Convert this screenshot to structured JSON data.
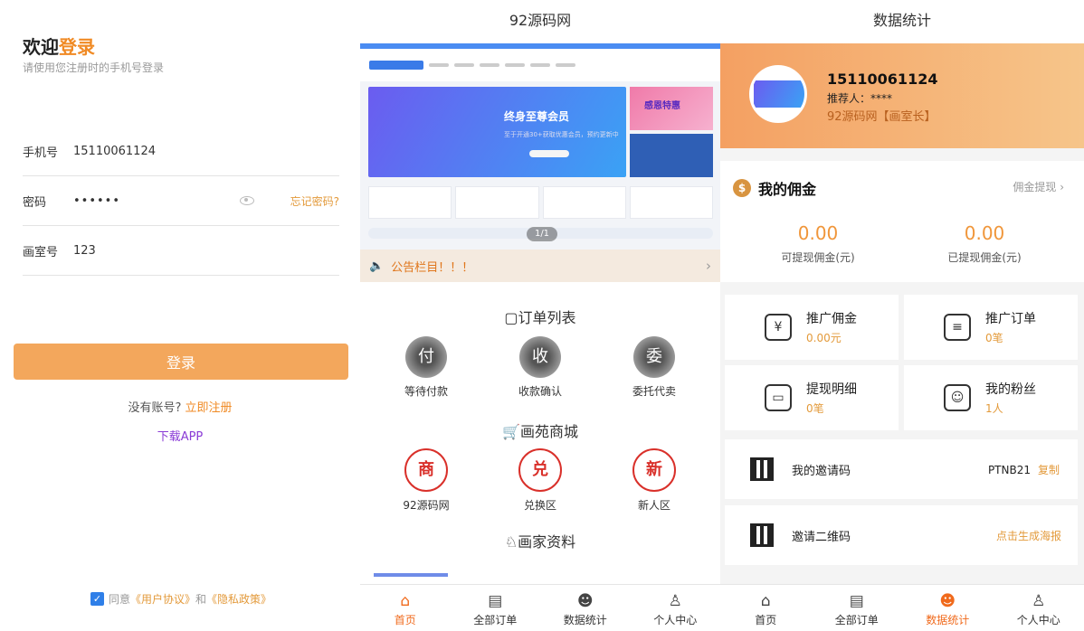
{
  "login": {
    "welcome_prefix": "欢迎",
    "welcome_highlight": "登录",
    "subtitle": "请使用您注册时的手机号登录",
    "phone_label": "手机号",
    "phone_value": "15110061124",
    "password_label": "密码",
    "password_value": "••••••",
    "forgot": "忘记密码?",
    "studio_label": "画室号",
    "studio_value": "123",
    "button": "登录",
    "no_account": "没有账号?",
    "register": "立即注册",
    "download": "下载APP",
    "agree_prefix": "同意",
    "user_agreement": "《用户协议》",
    "and": "和",
    "privacy": "《隐私政策》"
  },
  "home": {
    "title": "92源码网",
    "banner_headline": "终身至尊会员",
    "banner_sub": "至于开通30+获取优惠会员，预约更新中",
    "banner_side": "感恩特惠",
    "pager": "1/1",
    "notice": "公告栏目！！！",
    "orders_title": "订单列表",
    "orders": [
      {
        "glyph": "付",
        "label": "等待付款"
      },
      {
        "glyph": "收",
        "label": "收款确认"
      },
      {
        "glyph": "委",
        "label": "委托代卖"
      }
    ],
    "mall_title": "画苑商城",
    "mall": [
      {
        "glyph": "商",
        "label": "92源码网"
      },
      {
        "glyph": "兑",
        "label": "兑换区"
      },
      {
        "glyph": "新",
        "label": "新人区"
      }
    ],
    "artist_title": "画家资料"
  },
  "tabs": [
    {
      "icon": "⌂",
      "label": "首页"
    },
    {
      "icon": "▤",
      "label": "全部订单"
    },
    {
      "icon": "☻",
      "label": "数据统计"
    },
    {
      "icon": "♙",
      "label": "个人中心"
    }
  ],
  "stats": {
    "title": "数据统计",
    "name": "15110061124",
    "referrer": "推荐人：****",
    "studio": "92源码网【画室长】",
    "commission_title": "我的佣金",
    "withdraw_link": "佣金提现 ›",
    "withdrawable_value": "0.00",
    "withdrawable_label": "可提现佣金(元)",
    "withdrawn_value": "0.00",
    "withdrawn_label": "已提现佣金(元)",
    "cards": [
      {
        "icon": "¥",
        "title": "推广佣金",
        "sub": "0.00元"
      },
      {
        "icon": "≡",
        "title": "推广订单",
        "sub": "0笔"
      },
      {
        "icon": "▭",
        "title": "提现明细",
        "sub": "0笔"
      },
      {
        "icon": "☺",
        "title": "我的粉丝",
        "sub": "1人"
      }
    ],
    "invite_code_label": "我的邀请码",
    "invite_code": "PTNB21",
    "copy": "复制",
    "qr_label": "邀请二维码",
    "qr_action": "点击生成海报"
  },
  "colors": {
    "accent": "#f08a24",
    "button": "#f3a75c",
    "profile_bg": "#f4a062"
  }
}
